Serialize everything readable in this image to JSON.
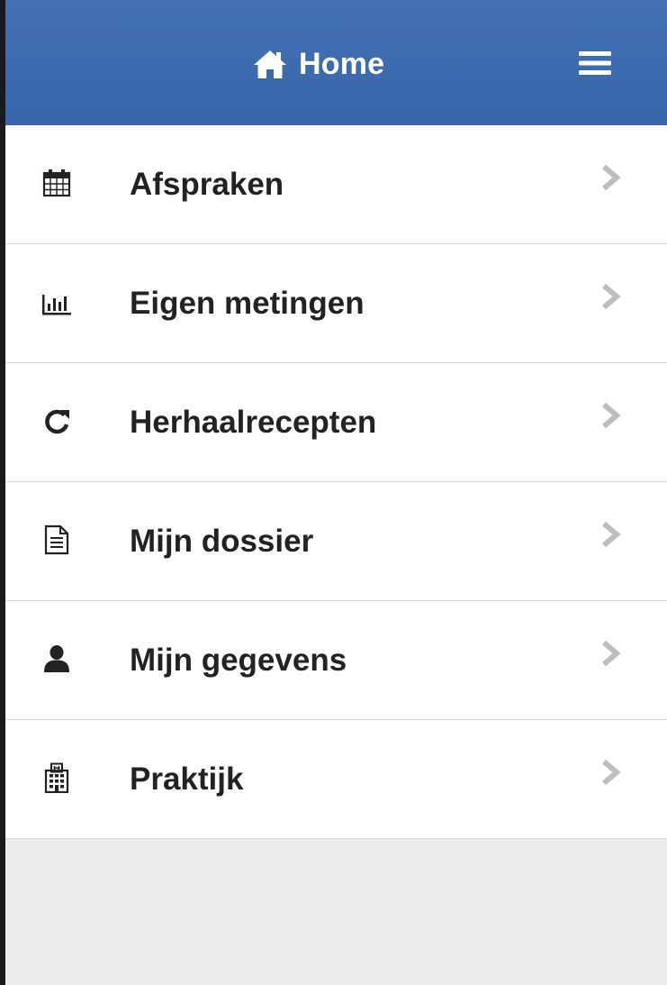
{
  "header": {
    "title": "Home",
    "home_icon": "home-icon",
    "menu_icon": "hamburger-menu-icon",
    "background_color": "#3a68ad",
    "text_color": "#ffffff"
  },
  "menu": {
    "items": [
      {
        "label": "Afspraken",
        "icon": "calendar-icon"
      },
      {
        "label": "Eigen metingen",
        "icon": "bar-chart-icon"
      },
      {
        "label": "Herhaalrecepten",
        "icon": "refresh-icon"
      },
      {
        "label": "Mijn dossier",
        "icon": "document-icon"
      },
      {
        "label": "Mijn gegevens",
        "icon": "user-icon"
      },
      {
        "label": "Praktijk",
        "icon": "hospital-icon"
      }
    ],
    "chevron_icon": "chevron-right-icon",
    "chevron_color": "#bdbdbd"
  },
  "footer": {
    "background_color": "#ededed"
  }
}
